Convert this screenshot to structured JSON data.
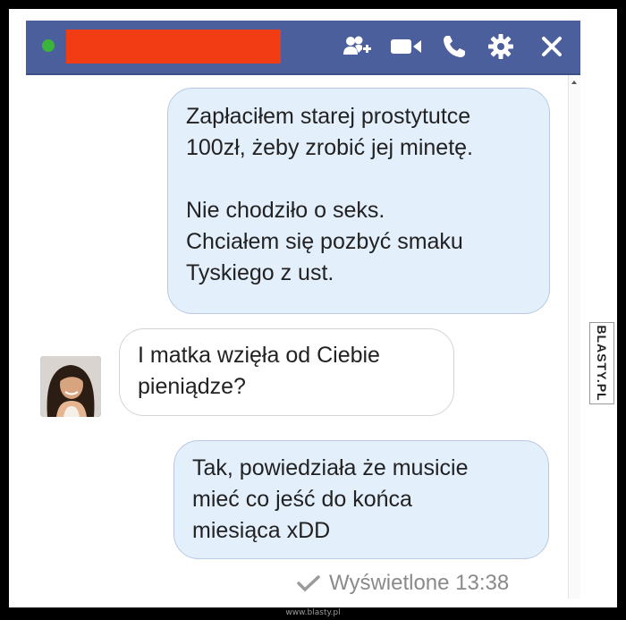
{
  "chat": {
    "messages": [
      {
        "sender": "me",
        "text": "Zapłaciłem starej prostytutce\n100zł, żeby zrobić jej minetę.\n\nNie chodziło o seks.\nChciałem się pozbyć smaku\nTyskiego z ust."
      },
      {
        "sender": "them",
        "text": "I matka wzięła od Ciebie\npieniądze?"
      },
      {
        "sender": "me",
        "text": "Tak, powiedziała że musicie\nmieć co jeść do końca\nmiesiąca xDD"
      }
    ],
    "seen_status": "Wyświetlone 13:38"
  },
  "header": {
    "status": "online",
    "icons": [
      "add-friend-icon",
      "video-call-icon",
      "phone-icon",
      "gear-icon",
      "close-icon"
    ]
  },
  "watermark": {
    "side_logo": "BLASTY.PL",
    "footer_url": "www.blasty.pl"
  },
  "colors": {
    "header_bg": "#4a5f9c",
    "online_dot": "#3cb43c",
    "redaction": "#f23c14",
    "my_bubble": "#e4effc",
    "their_bubble": "#ffffff"
  }
}
